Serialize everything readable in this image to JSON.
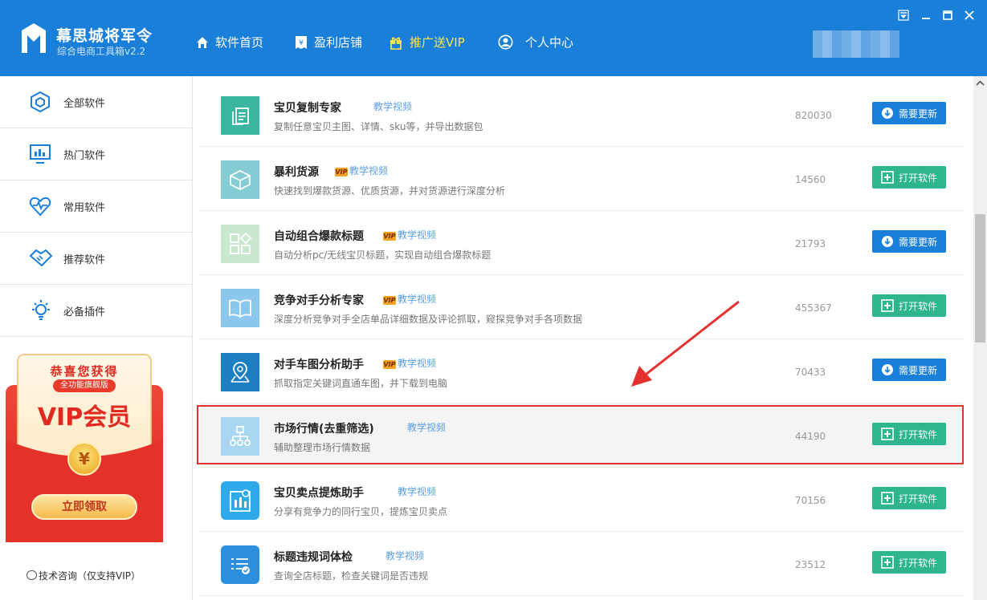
{
  "app": {
    "title": "幕思城将军令",
    "subtitle": "综合电商工具箱v2.2"
  },
  "nav": [
    {
      "label": "软件首页",
      "icon": "home-icon"
    },
    {
      "label": "盈利店铺",
      "icon": "shop-icon"
    },
    {
      "label": "推广送VIP",
      "icon": "gift-icon"
    },
    {
      "label": "个人中心",
      "icon": "user-icon"
    }
  ],
  "sidebar": {
    "items": [
      {
        "label": "全部软件",
        "icon": "cube-icon"
      },
      {
        "label": "热门软件",
        "icon": "chart-icon"
      },
      {
        "label": "常用软件",
        "icon": "heartbeat-icon"
      },
      {
        "label": "推荐软件",
        "icon": "handshake-icon"
      },
      {
        "label": "必备插件",
        "icon": "bulb-icon"
      }
    ],
    "promo": {
      "headline": "恭喜您获得",
      "ribbon": "全功能旗舰版",
      "title": "VIP会员",
      "coin": "¥",
      "cta": "立即领取"
    },
    "support": "技术咨询（仅支持VIP）"
  },
  "software": [
    {
      "name": "宝贝复制专家",
      "vip": false,
      "tutorial": "教学视频",
      "desc": "复制任意宝贝主图、详情、sku等，并导出数据包",
      "count": "820030",
      "action": "需要更新",
      "action_type": "update",
      "icon_color": "#3ab5a0"
    },
    {
      "name": "暴利货源",
      "vip": true,
      "tutorial": "教学视频",
      "desc": "快速找到爆款货源、优质货源，并对货源进行深度分析",
      "count": "14560",
      "action": "打开软件",
      "action_type": "open",
      "icon_color": "#86ccd4"
    },
    {
      "name": "自动组合爆款标题",
      "vip": true,
      "tutorial": "教学视频",
      "desc": "自动分析pc/无线宝贝标题，实现自动组合爆款标题",
      "count": "21793",
      "action": "需要更新",
      "action_type": "update",
      "icon_color": "#c9e8cf"
    },
    {
      "name": "竞争对手分析专家",
      "vip": true,
      "tutorial": "教学视频",
      "desc": "深度分析竞争对手全店单品详细数据及评论抓取，窥探竞争对手各项数据",
      "count": "455367",
      "action": "打开软件",
      "action_type": "open",
      "icon_color": "#8cc8ee"
    },
    {
      "name": "对手车图分析助手",
      "vip": true,
      "tutorial": "教学视频",
      "desc": "抓取指定关键词直通车图，并下载到电脑",
      "count": "70433",
      "action": "需要更新",
      "action_type": "update",
      "icon_color": "#1c7fc2"
    },
    {
      "name": "市场行情(去重筛选)",
      "vip": false,
      "tutorial": "教学视频",
      "desc": "辅助整理市场行情数据",
      "count": "44190",
      "action": "打开软件",
      "action_type": "open",
      "icon_color": "#a9d6f0"
    },
    {
      "name": "宝贝卖点提炼助手",
      "vip": false,
      "tutorial": "教学视频",
      "desc": "分享有竞争力的同行宝贝，提炼宝贝卖点",
      "count": "70156",
      "action": "打开软件",
      "action_type": "open",
      "icon_color": "#2ea9ea"
    },
    {
      "name": "标题违规词体检",
      "vip": false,
      "tutorial": "教学视频",
      "desc": "查询全店标题，检查关键词是否违规",
      "count": "23512",
      "action": "打开软件",
      "action_type": "open",
      "icon_color": "#2b8fe0"
    }
  ],
  "vip_badge": "VIP"
}
